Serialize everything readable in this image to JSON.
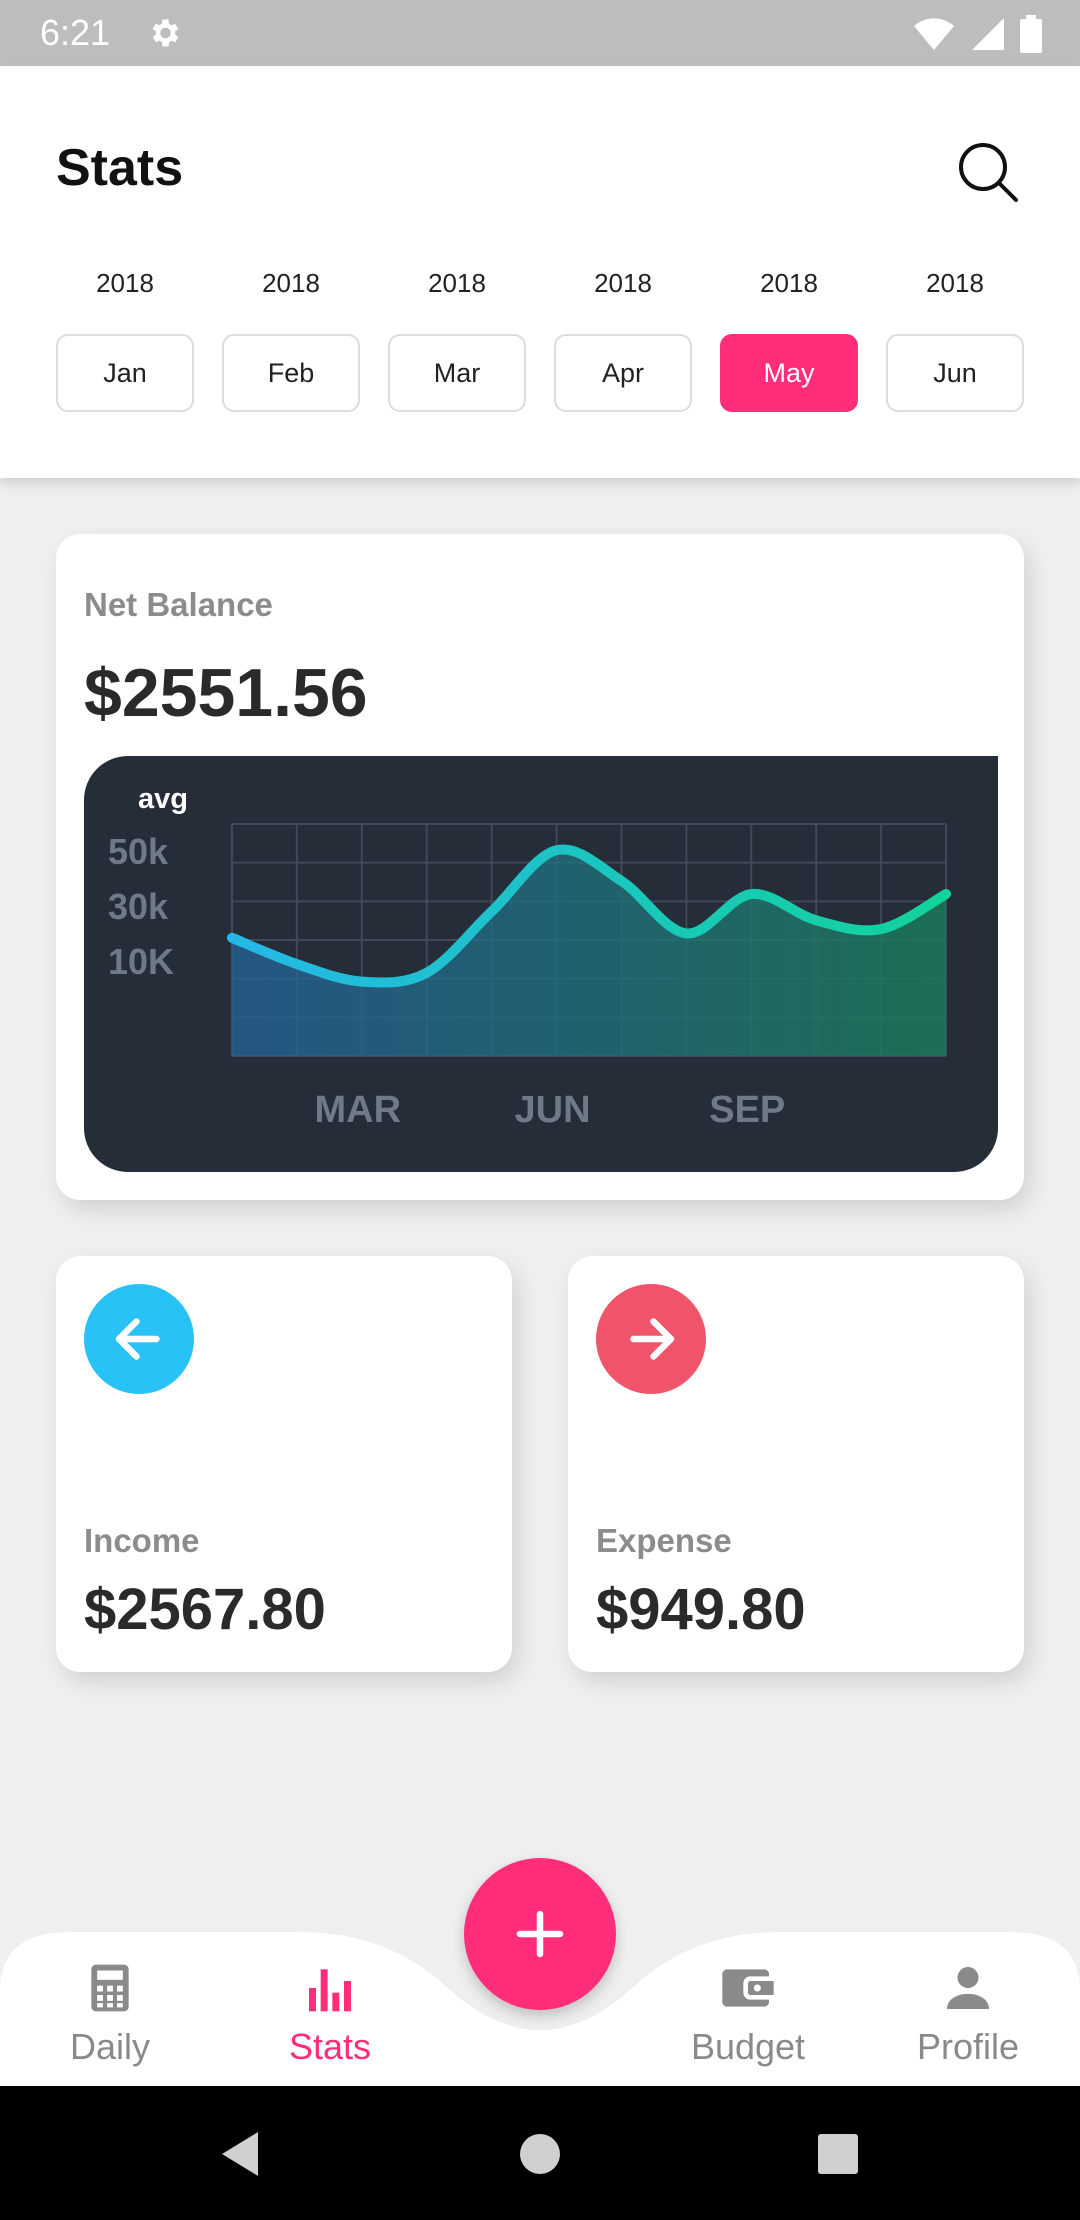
{
  "status_bar": {
    "time": "6:21"
  },
  "header": {
    "title": "Stats"
  },
  "months": [
    {
      "year": "2018",
      "label": "Jan",
      "active": false
    },
    {
      "year": "2018",
      "label": "Feb",
      "active": false
    },
    {
      "year": "2018",
      "label": "Mar",
      "active": false
    },
    {
      "year": "2018",
      "label": "Apr",
      "active": false
    },
    {
      "year": "2018",
      "label": "May",
      "active": true
    },
    {
      "year": "2018",
      "label": "Jun",
      "active": false
    }
  ],
  "net_balance": {
    "label": "Net Balance",
    "value": "$2551.56"
  },
  "chart_data": {
    "type": "line",
    "legend_label": "avg",
    "y_tick_labels": [
      "50k",
      "30k",
      "10K"
    ],
    "x_tick_labels": [
      "MAR",
      "JUN",
      "SEP"
    ],
    "x": [
      0,
      1,
      2,
      3,
      4,
      5,
      6,
      7,
      8,
      9,
      10,
      11
    ],
    "values": [
      32,
      26,
      22,
      24,
      38,
      52,
      45,
      33,
      42,
      36,
      34,
      42
    ],
    "ylim": [
      5,
      58
    ],
    "grid": true,
    "colors": {
      "start": "#25b8e6",
      "end": "#12d39a",
      "fill": "#1f7a6e"
    }
  },
  "income": {
    "label": "Income",
    "value": "$2567.80",
    "color": "#29c2f7",
    "icon": "arrow-left-icon"
  },
  "expense": {
    "label": "Expense",
    "value": "$949.80",
    "color": "#f0546a",
    "icon": "arrow-right-icon"
  },
  "bottom_nav": {
    "items": [
      {
        "label": "Daily",
        "icon": "calculator-icon",
        "active": false
      },
      {
        "label": "Stats",
        "icon": "bar-chart-icon",
        "active": true
      },
      {
        "label": "Budget",
        "icon": "wallet-icon",
        "active": false
      },
      {
        "label": "Profile",
        "icon": "person-icon",
        "active": false
      }
    ],
    "fab_icon": "plus-icon",
    "accent": "#ff2d7a"
  }
}
